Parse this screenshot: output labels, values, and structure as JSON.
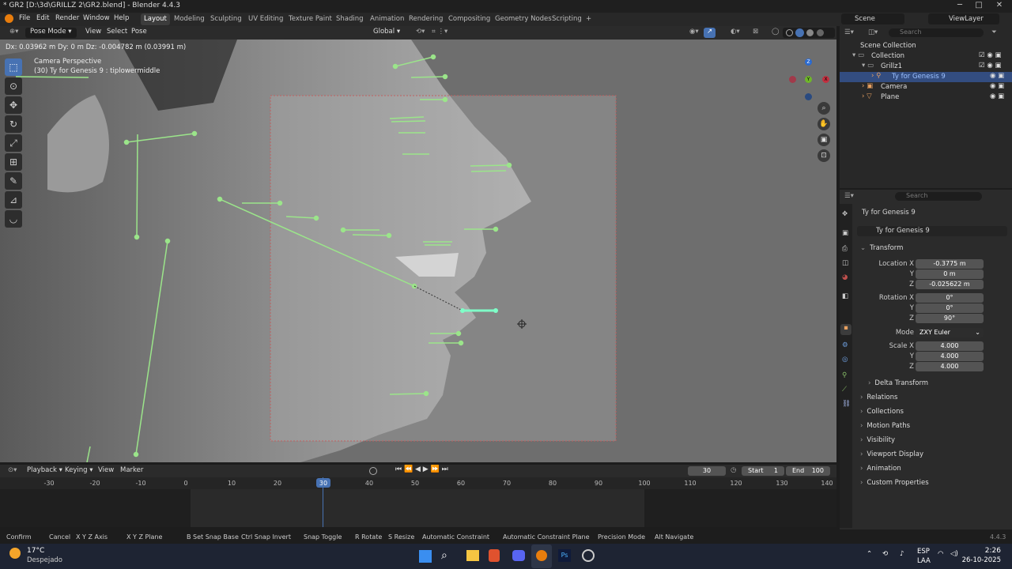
{
  "window": {
    "title": "* GR2 [D:\\3d\\GRILLZ 2\\GR2.blend] - Blender 4.4.3",
    "min": "─",
    "max": "□",
    "close": "✕"
  },
  "menu": [
    "File",
    "Edit",
    "Render",
    "Window",
    "Help"
  ],
  "workspaces": [
    "Layout",
    "Modeling",
    "Sculpting",
    "UV Editing",
    "Texture Paint",
    "Shading",
    "Animation",
    "Rendering",
    "Compositing",
    "Geometry Nodes",
    "Scripting",
    "+"
  ],
  "scene": {
    "name": "Scene",
    "view_layer": "ViewLayer"
  },
  "viewport_header": {
    "mode": "Pose Mode",
    "view": "View",
    "select": "Select",
    "pose": "Pose",
    "orientation": "Global"
  },
  "viewport": {
    "drag_info": "Dx: 0.03962 m   Dy: 0 m   Dz: -0.004782 m (0.03991 m)",
    "camera": "Camera Perspective",
    "object_info": "(30) Ty for Genesis 9 : tiplowermiddle"
  },
  "gizmo": {
    "x": "X",
    "y": "Y",
    "z": "Z"
  },
  "timeline": {
    "playback": "Playback",
    "keying": "Keying",
    "view": "View",
    "marker": "Marker",
    "current_frame": "30",
    "start_label": "Start",
    "start": "1",
    "end_label": "End",
    "end": "100",
    "ticks": [
      "-30",
      "-20",
      "-10",
      "0",
      "10",
      "20",
      "30",
      "40",
      "50",
      "60",
      "70",
      "80",
      "90",
      "100",
      "110",
      "120",
      "130",
      "140"
    ]
  },
  "status": {
    "items": [
      "Confirm",
      "Cancel",
      "X Y Z Axis",
      "X Y Z Plane",
      "B Set Snap Base",
      "Ctrl Snap Invert",
      "Snap Toggle",
      "R Rotate",
      "S Resize",
      "Automatic Constraint",
      "Automatic Constraint Plane",
      "Precision Mode",
      "Alt Navigate"
    ],
    "version": "4.4.3"
  },
  "outliner": {
    "search_placeholder": "Search",
    "rows": [
      {
        "label": "Scene Collection"
      },
      {
        "label": "Collection"
      },
      {
        "label": "Grillz1"
      },
      {
        "label": "Ty for Genesis 9"
      },
      {
        "label": "Camera"
      },
      {
        "label": "Plane"
      }
    ]
  },
  "properties": {
    "search_placeholder": "Search",
    "object_name": "Ty for Genesis 9",
    "data_name": "Ty for Genesis 9",
    "transform_label": "Transform",
    "location_label": "Location X",
    "loc": {
      "x": "-0.3775 m",
      "y": "0 m",
      "z": "-0.025622 m"
    },
    "rotation_label": "Rotation X",
    "rot": {
      "x": "0°",
      "y": "0°",
      "z": "90°"
    },
    "mode_label": "Mode",
    "mode": "ZXY Euler",
    "scale_label": "Scale X",
    "scale": {
      "x": "4.000",
      "y": "4.000",
      "z": "4.000"
    },
    "y_label": "Y",
    "z_label": "Z",
    "sections": [
      "Delta Transform",
      "Relations",
      "Collections",
      "Motion Paths",
      "Visibility",
      "Viewport Display",
      "Animation",
      "Custom Properties"
    ]
  },
  "taskbar": {
    "weather_temp": "17°C",
    "weather_text": "Despejado",
    "lang": "ESP",
    "lang2": "LAA",
    "time": "2:26",
    "date": "26-10-2025"
  },
  "colors": {
    "accent": "#4772b3",
    "bone": "#9be58a",
    "active_bone": "#7fffc8",
    "viewport": "#7e7e7e"
  }
}
